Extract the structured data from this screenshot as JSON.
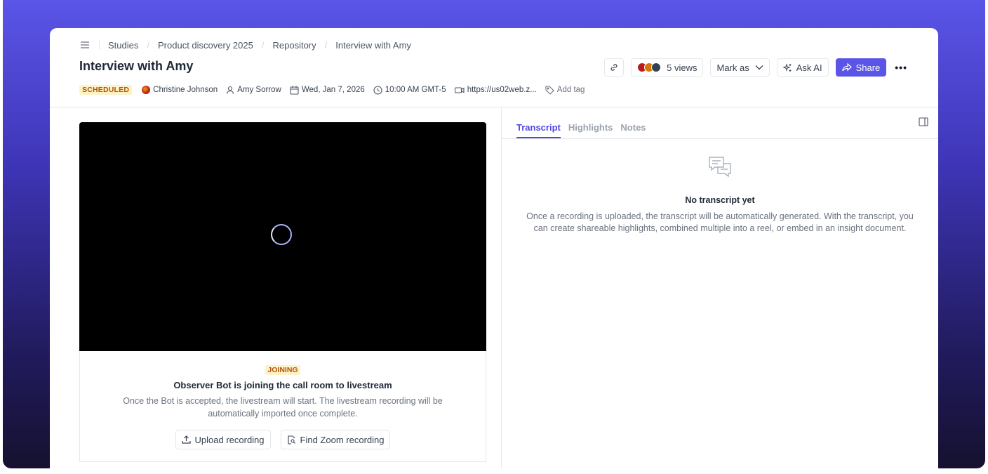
{
  "breadcrumb": {
    "items": [
      "Studies",
      "Product discovery 2025",
      "Repository",
      "Interview with Amy"
    ]
  },
  "page": {
    "title": "Interview with Amy",
    "status": "SCHEDULED",
    "owner": "Christine Johnson",
    "participant": "Amy Sorrow",
    "date": "Wed, Jan 7, 2026",
    "time": "10:00 AM GMT-5",
    "meeting_link": "https://us02web.z...",
    "add_tag": "Add tag"
  },
  "actions": {
    "views": "5 views",
    "mark_as": "Mark as",
    "ask_ai": "Ask AI",
    "share": "Share",
    "more": "•••"
  },
  "recording": {
    "status": "JOINING",
    "title": "Observer Bot is joining the call room to livestream",
    "description": "Once the Bot is accepted, the livestream will start. The livestream recording will be automatically imported once complete.",
    "upload_label": "Upload recording",
    "find_zoom_label": "Find Zoom recording"
  },
  "tabs": [
    "Transcript",
    "Highlights",
    "Notes"
  ],
  "transcript": {
    "empty_title": "No transcript yet",
    "empty_desc": "Once a recording is uploaded, the transcript will be automatically generated. With the transcript, you can create shareable highlights, combined multiple into a reel, or embed in an insight document."
  },
  "icons": {
    "menu": "menu-icon",
    "link": "link-icon",
    "sparkle": "sparkle-icon",
    "share": "share-icon",
    "calendar": "calendar-icon",
    "clock": "clock-icon",
    "video": "video-icon",
    "tag": "tag-icon",
    "user": "user-icon",
    "upload": "upload-icon",
    "search-file": "file-search-icon",
    "chat": "chat-bubbles-icon",
    "panel": "sidebar-panel-icon"
  },
  "colors": {
    "accent": "#5a55e6",
    "badge_text": "#b45309",
    "badge_bg": "#fef3c7"
  }
}
